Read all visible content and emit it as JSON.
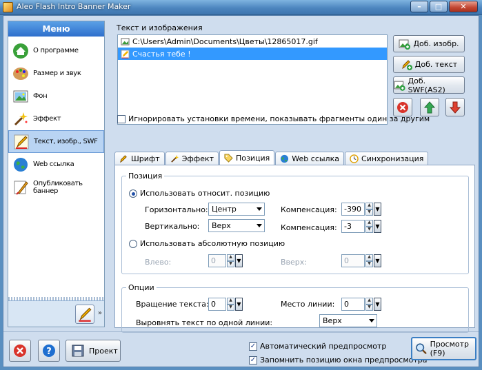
{
  "window": {
    "title": "Aleo Flash Intro Banner Maker"
  },
  "menu": {
    "header": "Меню",
    "items": [
      {
        "label": "О программе",
        "icon": "home-icon"
      },
      {
        "label": "Размер и звук",
        "icon": "palette-icon"
      },
      {
        "label": "Фон",
        "icon": "picture-icon"
      },
      {
        "label": "Эффект",
        "icon": "sparkle-icon"
      },
      {
        "label": "Текст, изобр., SWF",
        "icon": "pen-icon",
        "selected": true
      },
      {
        "label": "Web ссылка",
        "icon": "globe-icon"
      },
      {
        "label": "Опубликовать баннер",
        "icon": "brush-icon"
      }
    ]
  },
  "content": {
    "section_title": "Текст и изображения",
    "items": [
      {
        "label": "C:\\Users\\Admin\\Documents\\Цветы\\12865017.gif",
        "icon": "image-icon"
      },
      {
        "label": "Счастья тебе !",
        "icon": "text-icon",
        "selected": true
      }
    ],
    "buttons": {
      "add_image": "Доб. изобр.",
      "add_text": "Доб. текст",
      "add_swf": "Доб. SWF(AS2)"
    },
    "ignore_time_label": "Игнорировать установки времени, показывать фрагменты один за другим"
  },
  "tabs": [
    {
      "label": "Шрифт",
      "icon": "font-icon"
    },
    {
      "label": "Эффект",
      "icon": "wand-icon"
    },
    {
      "label": "Позиция",
      "icon": "tag-icon",
      "active": true
    },
    {
      "label": "Web ссылка",
      "icon": "globe-icon"
    },
    {
      "label": "Синхронизация",
      "icon": "clock-icon"
    }
  ],
  "position": {
    "group_title": "Позиция",
    "relative_label": "Использовать относит. позицию",
    "horizontal_label": "Горизонтально:",
    "horizontal_value": "Центр",
    "vertical_label": "Вертикально:",
    "vertical_value": "Верх",
    "compensation_label": "Компенсация:",
    "h_compensation": "-390",
    "v_compensation": "-3",
    "absolute_label": "Использовать абсолютную позицию",
    "left_label": "Влево:",
    "left_value": "0",
    "top_label": "Вверх:",
    "top_value": "0"
  },
  "options": {
    "group_title": "Опции",
    "rotation_label": "Вращение текста:",
    "rotation_value": "0",
    "line_place_label": "Место линии:",
    "line_place_value": "0",
    "align_label": "Выровнять текст по одной линии:",
    "align_value": "Верх"
  },
  "bottom": {
    "project_label": "Проект",
    "auto_preview_label": "Автоматический предпросмотр",
    "remember_position_label": "Запомнить позицию окна предпросмотра",
    "preview_label": "Просмотр (F9)"
  }
}
